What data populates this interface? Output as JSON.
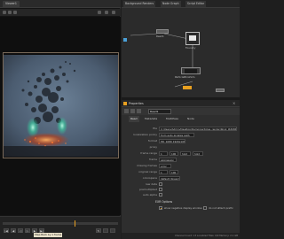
{
  "viewer": {
    "tab_label": "Viewer1",
    "timeline": {
      "progress": 0.62,
      "tooltip": "Step Back by 1 frame"
    }
  },
  "node_graph": {
    "tabs": [
      "Background Renders",
      "Node Graph",
      "Script Editor"
    ],
    "nodes": [
      "Read1",
      "Foundry",
      "ParticleBlinkSim",
      "Viewer1",
      "Write1"
    ]
  },
  "properties": {
    "panel_title": "Properties",
    "node_name": "Read1",
    "tabs": [
      "Read",
      "Metadata",
      "MultiPass",
      "Node"
    ],
    "fields": {
      "file_label": "file",
      "file_value": "C:/Users/Admin/Desktop/Demo/particles_render/blink_####.exr",
      "localization_label": "localization policy",
      "localization_value": "from auto-localize path",
      "format_label": "format",
      "format_value": "HD_1080 1920x1080",
      "proxy_label": "proxy",
      "frame_range_label": "frame range",
      "frame_range_start": "1",
      "frame_range_end": "100",
      "before_value": "hold",
      "after_value": "hold",
      "frame_label": "frame",
      "frame_value": "expression",
      "missing_frames_label": "missing frames",
      "missing_frames_value": "error",
      "original_range_label": "original range",
      "original_start": "1",
      "original_end": "100",
      "colorspace_label": "colorspace",
      "colorspace_value": "default (linear)",
      "raw_data_label": "raw data",
      "premultiplied_label": "premultiplied",
      "auto_alpha_label": "auto alpha",
      "exr_section": "EXR Options",
      "opt1_label": "show negative display window",
      "opt2_label": "do not attach prefix"
    }
  },
  "status_bar": {
    "text": "Channel Count: 13 Localized Files: 0/0 Memory: 2.1 GB"
  },
  "colors": {
    "accent": "#e8a020",
    "background": "#1e1e1e",
    "panel": "#2e2e2e"
  }
}
